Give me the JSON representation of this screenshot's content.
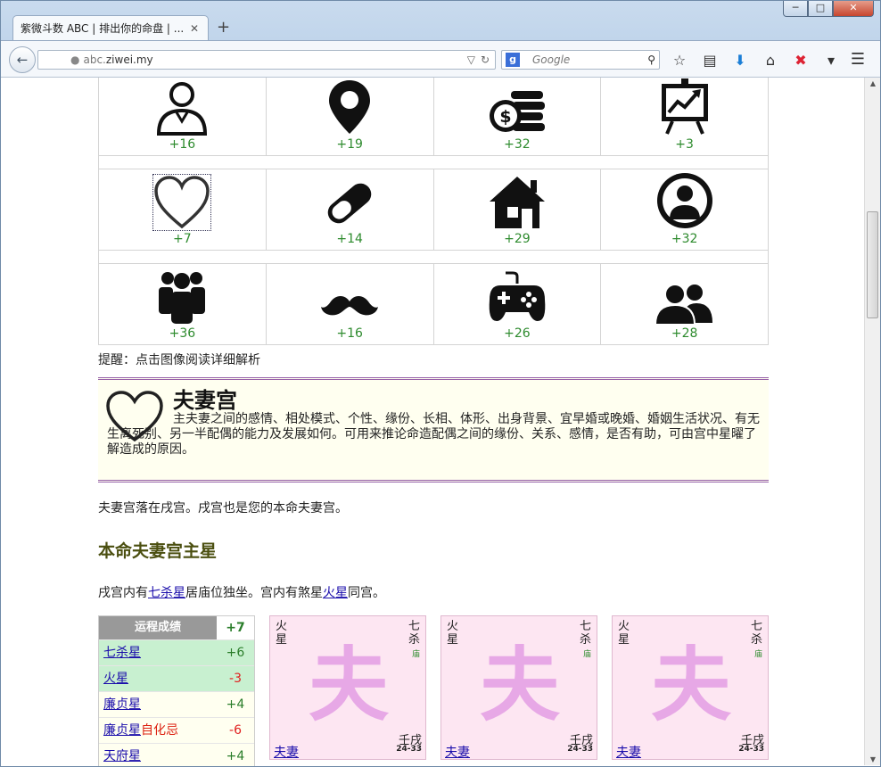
{
  "browser": {
    "tab_title": "紫微斗数 ABC | 排出你的命盘 | ...",
    "tab_close": "✕",
    "new_tab": "+",
    "url_gray": "abc.",
    "url_bold": "ziwei.my",
    "search_placeholder": "Google",
    "window_controls": {
      "minimize": "─",
      "maximize": "□",
      "close": "✕"
    }
  },
  "palace_grid": [
    {
      "icon": "person-icon",
      "score": "+16"
    },
    {
      "icon": "location-pin-icon",
      "score": "+19"
    },
    {
      "icon": "coins-icon",
      "score": "+32"
    },
    {
      "icon": "chart-board-icon",
      "score": "+3"
    },
    {
      "icon": "heart-icon",
      "score": "+7"
    },
    {
      "icon": "pill-icon",
      "score": "+14"
    },
    {
      "icon": "house-icon",
      "score": "+29"
    },
    {
      "icon": "user-circle-icon",
      "score": "+32"
    },
    {
      "icon": "group-icon",
      "score": "+36"
    },
    {
      "icon": "mustache-icon",
      "score": "+16"
    },
    {
      "icon": "gamepad-icon",
      "score": "+26"
    },
    {
      "icon": "two-users-icon",
      "score": "+28"
    }
  ],
  "hint": "提醒：点击图像阅读详细解析",
  "palace": {
    "title": "夫妻宫",
    "description": "主夫妻之间的感情、相处模式、个性、缘份、长相、体形、出身背景、宜早婚或晚婚、婚姻生活状况、有无生离死别、另一半配偶的能力及发展如何。可用来推论命造配偶之间的缘份、关系、感情，是否有助，可由宫中星曜了解造成的原因。"
  },
  "location_text": "夫妻宫落在戌宫。戌宫也是您的本命夫妻宫。",
  "section_title": "本命夫妻宫主星",
  "stars_line": {
    "prefix": "戌宫内有",
    "star1": "七杀星",
    "mid": "居庙位独坐。宫内有煞星",
    "star2": "火星",
    "suffix": "同宫。"
  },
  "fortune_table": {
    "header_label": "运程成绩",
    "header_value": "+7",
    "rows": [
      {
        "name": "七杀星",
        "suffix": "",
        "value": "+6"
      },
      {
        "name": "火星",
        "suffix": "",
        "value": "-3"
      },
      {
        "name": "廉贞星",
        "suffix": "",
        "value": "+4"
      },
      {
        "name": "廉贞星",
        "suffix": "自化忌",
        "value": "-6"
      },
      {
        "name": "天府星",
        "suffix": "",
        "value": "+4"
      }
    ]
  },
  "palace_cards": [
    {
      "left_star": "火星",
      "right_star": "七杀",
      "right_status": "庙",
      "big_char": "夫",
      "ganzhi": "壬戌",
      "age": "24-33",
      "name": "夫妻"
    },
    {
      "left_star": "火星",
      "right_star": "七杀",
      "right_status": "庙",
      "big_char": "夫",
      "ganzhi": "壬戌",
      "age": "24-33",
      "name": "夫妻"
    },
    {
      "left_star": "火星",
      "right_star": "七杀",
      "right_status": "庙",
      "big_char": "夫",
      "ganzhi": "壬戌",
      "age": "24-33",
      "name": "夫妻"
    }
  ]
}
